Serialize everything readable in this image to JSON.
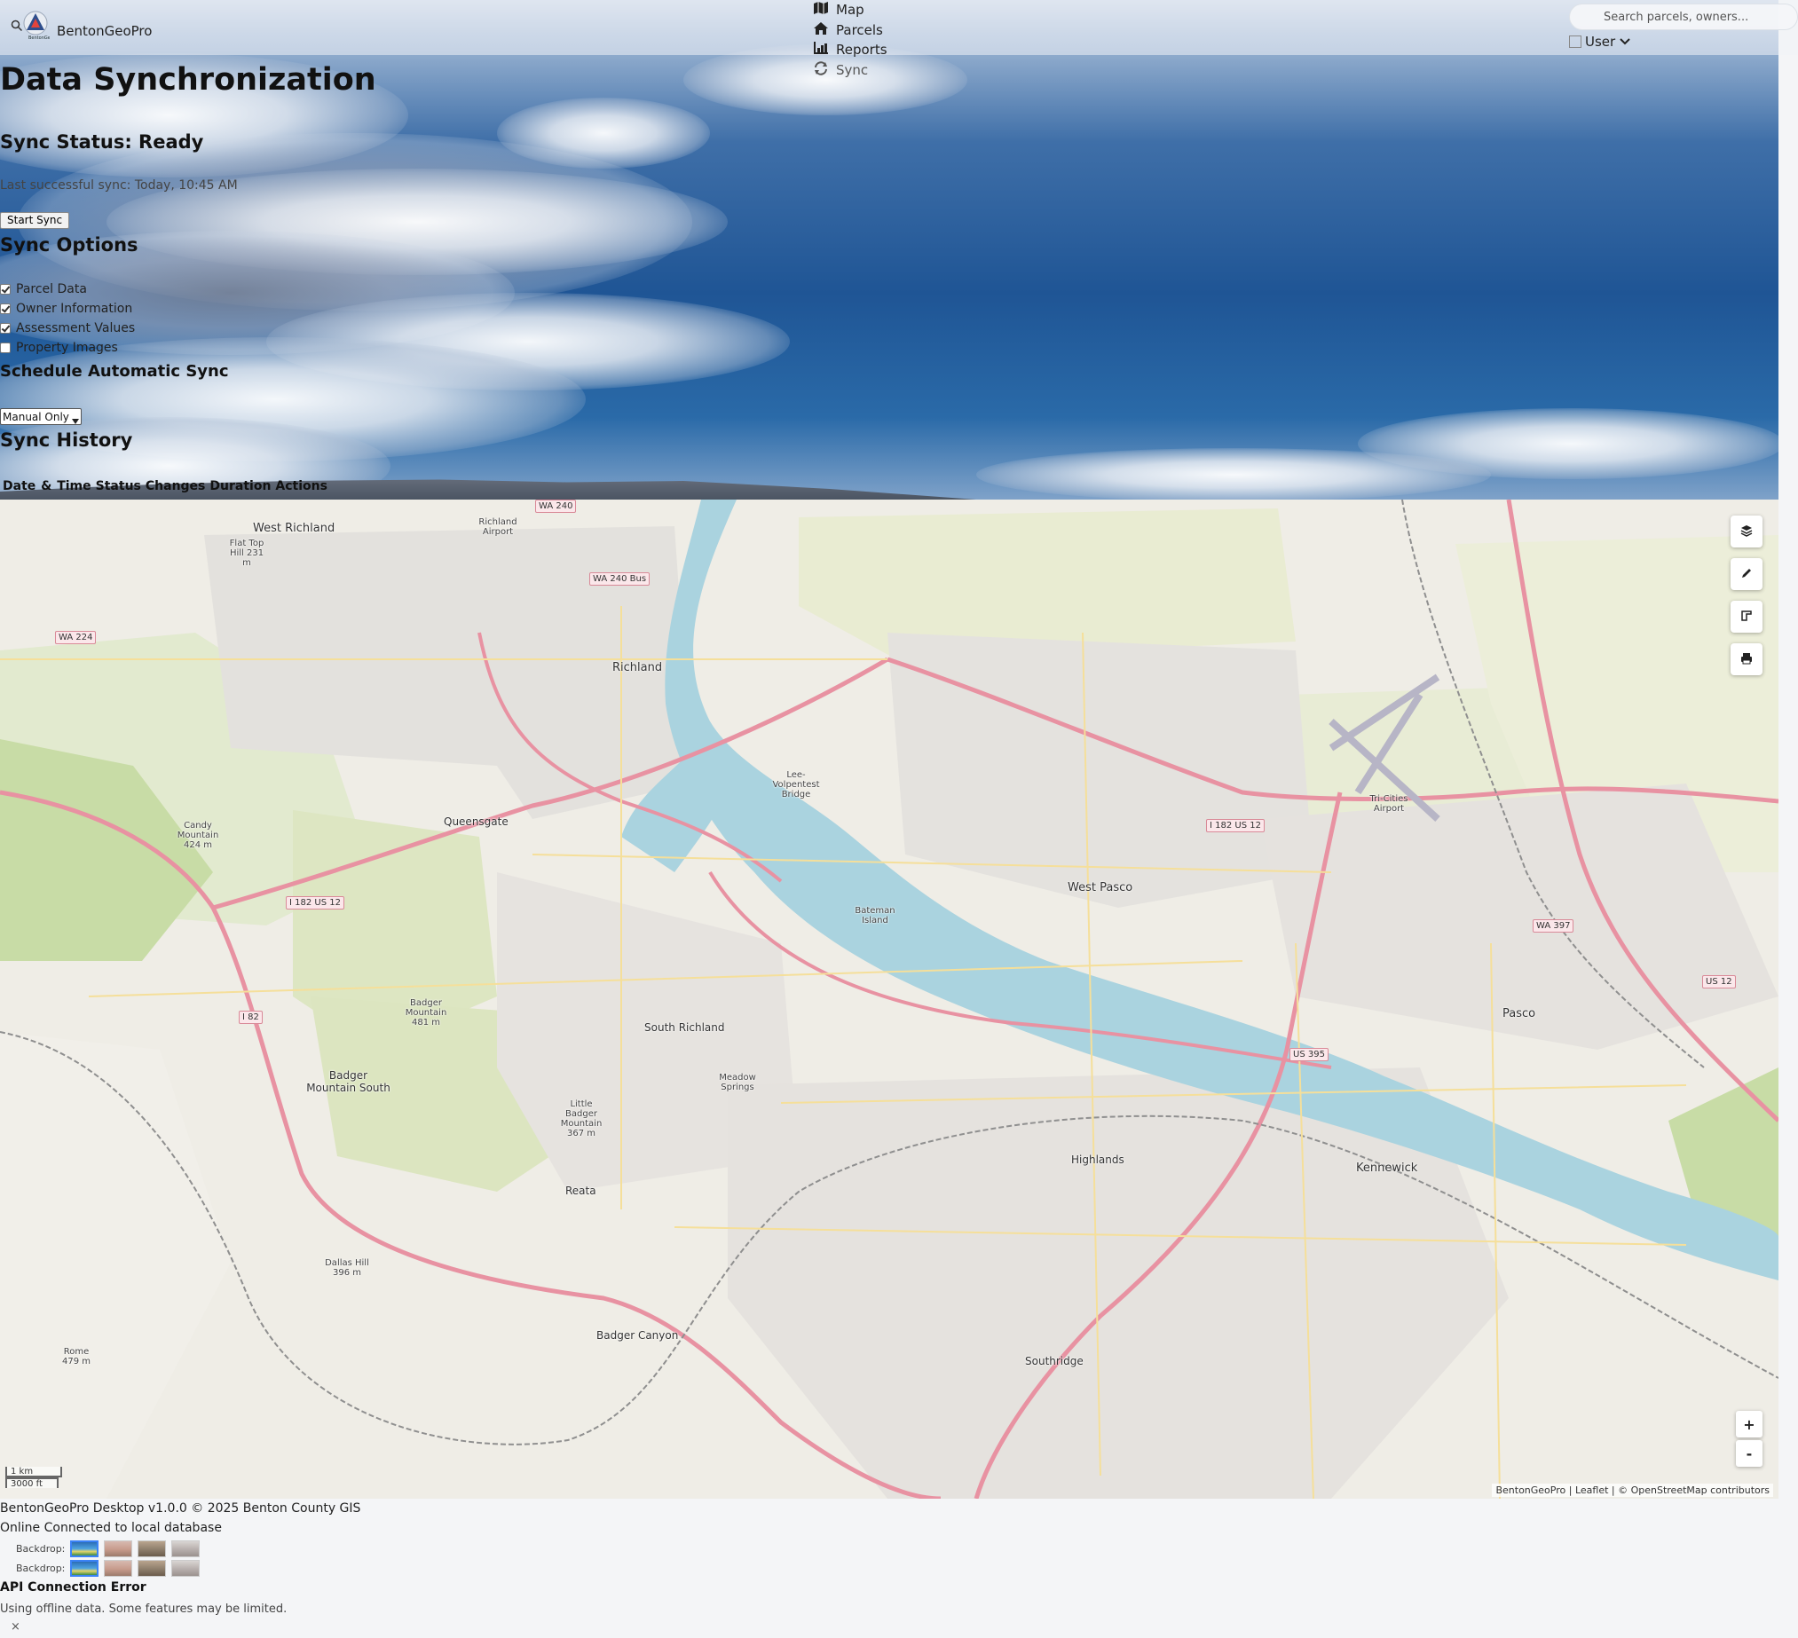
{
  "app": {
    "name": "BentonGeoPro",
    "logo_text": "BentonGeoPro"
  },
  "nav": {
    "items": [
      {
        "label": "Map",
        "icon": "map-icon"
      },
      {
        "label": "Parcels",
        "icon": "home-icon"
      },
      {
        "label": "Reports",
        "icon": "chart-icon"
      },
      {
        "label": "Sync",
        "icon": "sync-icon"
      }
    ]
  },
  "search": {
    "placeholder": "Search parcels, owners..."
  },
  "user": {
    "label": "User"
  },
  "page": {
    "title": "Data Synchronization",
    "status_heading": "Sync Status: Ready",
    "last_sync": "Last successful sync: Today, 10:45 AM",
    "start_button": "Start Sync",
    "options_heading": "Sync Options",
    "options": [
      {
        "label": "Parcel Data",
        "checked": true
      },
      {
        "label": "Owner Information",
        "checked": true
      },
      {
        "label": "Assessment Values",
        "checked": true
      },
      {
        "label": "Property Images",
        "checked": false
      }
    ],
    "schedule_heading": "Schedule Automatic Sync",
    "schedule_value": "Manual Only",
    "history_heading": "Sync History",
    "history_columns": [
      "Date & Time",
      "Status",
      "Changes",
      "Duration",
      "Actions"
    ]
  },
  "map": {
    "labels": {
      "west_richland": "West Richland",
      "richland": "Richland",
      "queensgate": "Queensgate",
      "west_pasco": "West Pasco",
      "pasco": "Pasco",
      "kennewick": "Kennewick",
      "south_richland": "South Richland",
      "badger_mountain_south": "Badger Mountain South",
      "highlands": "Highlands",
      "southridge": "Southridge",
      "badger_canyon": "Badger Canyon",
      "reata": "Reata",
      "bateman_island": "Bateman Island",
      "lee_bridge": "Lee-Volpentest Bridge",
      "rome": "Rome 479 m",
      "dallas_hill": "Dallas Hill 396 m",
      "badger_mountain": "Badger Mountain 481 m",
      "candy_mountain": "Candy Mountain 424 m",
      "tri_cities_airport": "Tri-Cities Airport",
      "richland_airport": "Richland Airport",
      "flat_top_hill": "Flat Top Hill 231 m",
      "meadow_springs": "Meadow Springs",
      "little_badger": "Little Badger Mountain 367 m"
    },
    "shields": [
      "WA 240",
      "WA 224",
      "WA 240 Bus",
      "I 182 US 12",
      "I 82",
      "US 395",
      "WA 397",
      "US 12",
      "I 182 US 12"
    ],
    "scale": {
      "metric": "1 km",
      "imperial": "3000 ft"
    },
    "attribution": "BentonGeoPro | Leaflet | © OpenStreetMap contributors",
    "zoom_in": "+",
    "zoom_out": "-"
  },
  "footer": {
    "version": "BentonGeoPro Desktop v1.0.0 © 2025 Benton County GIS",
    "status": "Online Connected to local database",
    "backdrop_label": "Backdrop:",
    "error_title": "API Connection Error",
    "error_message": "Using offline data. Some features may be limited.",
    "close": "×"
  },
  "colors": {
    "accent": "#3b82f6",
    "river": "#aad3df",
    "highway": "#e892a2",
    "park": "#c8dca6"
  }
}
